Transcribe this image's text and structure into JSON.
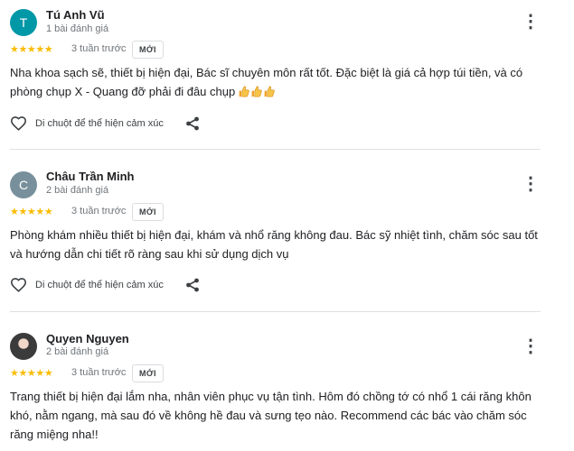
{
  "reviews": [
    {
      "avatar_initial": "T",
      "avatar_color": "#0097a7",
      "name": "Tú Anh Vũ",
      "review_count": "1 bài đánh giá",
      "stars": "★★★★★",
      "rating": 5,
      "time": "3 tuần trước",
      "badge": "MỚI",
      "text": "Nha khoa sạch sẽ, thiết bị hiện đại, Bác sĩ chuyên môn rất tốt. Đặc biệt là giá cả hợp túi tiền, và có phòng chụp X - Quang đỡ phải đi đâu chụp",
      "emojis": [
        "thumbs-up",
        "thumbs-up",
        "thumbs-up"
      ],
      "reaction_label": "Di chuột để thể hiện cảm xúc"
    },
    {
      "avatar_initial": "C",
      "avatar_color": "#78909c",
      "name": "Châu Trần Minh",
      "review_count": "2 bài đánh giá",
      "stars": "★★★★★",
      "rating": 5,
      "time": "3 tuần trước",
      "badge": "MỚI",
      "text": "Phòng khám nhiều thiết bị hiện đại, khám và nhổ răng không đau. Bác sỹ nhiệt tình, chăm sóc sau tốt và hướng dẫn chi tiết rõ ràng sau khi sử dụng dịch vụ",
      "reaction_label": "Di chuột để thể hiện cảm xúc"
    },
    {
      "name": "Quyen Nguyen",
      "review_count": "2 bài đánh giá",
      "stars": "★★★★★",
      "rating": 5,
      "time": "3 tuần trước",
      "badge": "MỚI",
      "text": "Trang thiết bị hiện đại lắm nha, nhân viên phục vụ tận tình. Hôm đó chồng tớ có nhổ 1 cái răng khôn khó, nằm ngang, mà sau đó về không hề đau và sưng tẹo nào. Recommend các bác vào chăm sóc răng miệng nha!!"
    }
  ],
  "colors": {
    "star": "#fbbc04",
    "text": "#202124",
    "muted": "#70757a",
    "divider": "#e0e0e0"
  }
}
